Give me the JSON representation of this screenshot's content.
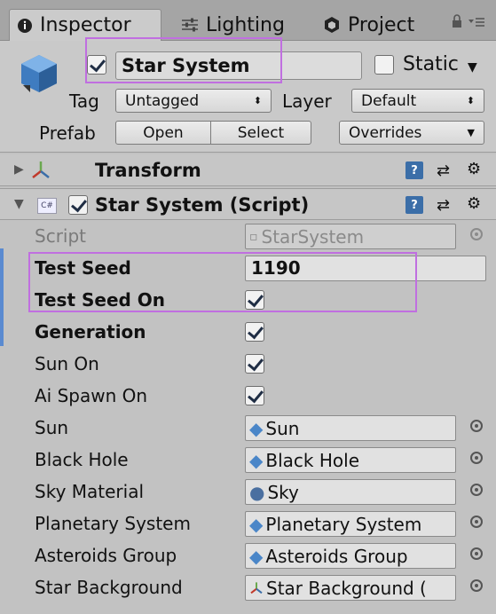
{
  "tabs": {
    "inspector": "Inspector",
    "lighting": "Lighting",
    "project": "Project"
  },
  "object": {
    "name": "Star System",
    "active": true,
    "static_label": "Static",
    "static": false,
    "tag_label": "Tag",
    "tag_value": "Untagged",
    "layer_label": "Layer",
    "layer_value": "Default",
    "prefab_label": "Prefab",
    "open_label": "Open",
    "select_label": "Select",
    "overrides_label": "Overrides"
  },
  "components": {
    "transform": {
      "title": "Transform"
    },
    "script": {
      "title": "Star System (Script)",
      "enabled": true,
      "script_label": "Script",
      "script_value": "StarSystem"
    }
  },
  "fields": {
    "test_seed": {
      "label": "Test Seed",
      "value": "1190"
    },
    "test_seed_on": {
      "label": "Test Seed On",
      "checked": true
    },
    "generation": {
      "label": "Generation",
      "checked": true
    },
    "sun_on": {
      "label": "Sun On",
      "checked": true
    },
    "ai_spawn_on": {
      "label": "Ai Spawn On",
      "checked": true
    },
    "sun": {
      "label": "Sun",
      "value": "Sun"
    },
    "black_hole": {
      "label": "Black Hole",
      "value": "Black Hole"
    },
    "sky_material": {
      "label": "Sky Material",
      "value": "Sky"
    },
    "planetary_system": {
      "label": "Planetary System",
      "value": "Planetary System"
    },
    "asteroids_group": {
      "label": "Asteroids Group",
      "value": "Asteroids Group"
    },
    "star_background": {
      "label": "Star Background",
      "value": "Star Background ("
    }
  },
  "colors": {
    "highlight": "#c06fe0",
    "prefab_blue": "#4a86c8",
    "check": "#1f2d44"
  }
}
